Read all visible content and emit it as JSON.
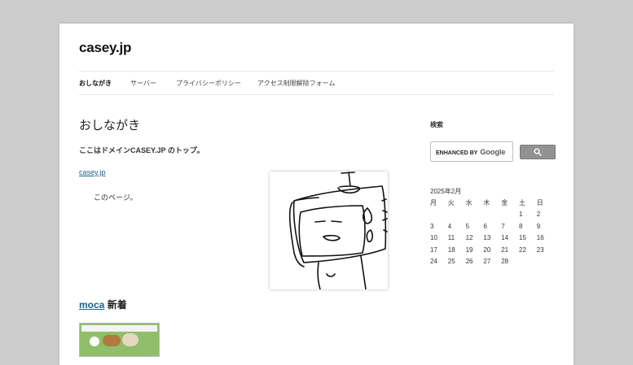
{
  "site": {
    "title": "casey.jp"
  },
  "nav": {
    "items": [
      {
        "label": "おしながき"
      },
      {
        "label": "サーバー"
      },
      {
        "label": "プライバシーポリシー"
      },
      {
        "label": "アクセス制限解除フォーム"
      }
    ]
  },
  "main": {
    "heading": "おしながき",
    "intro": "ここはドメインCASEY.JP のトップ。",
    "link_text": "casey.jp",
    "this_page": "このページ。",
    "moca_link": "moca",
    "moca_suffix": " 新着"
  },
  "sidebar": {
    "search_title": "検索",
    "search_brand": "ENHANCED BY",
    "search_brand_google": "Google",
    "calendar": {
      "caption": "2025年2月",
      "weekdays": [
        "月",
        "火",
        "水",
        "木",
        "金",
        "土",
        "日"
      ],
      "rows": [
        [
          "",
          "",
          "",
          "",
          "",
          "1",
          "2"
        ],
        [
          "3",
          "4",
          "5",
          "6",
          "7",
          "8",
          "9"
        ],
        [
          "10",
          "11",
          "12",
          "13",
          "14",
          "15",
          "16"
        ],
        [
          "17",
          "18",
          "19",
          "20",
          "21",
          "22",
          "23"
        ],
        [
          "24",
          "25",
          "26",
          "27",
          "28",
          "",
          ""
        ]
      ]
    }
  }
}
